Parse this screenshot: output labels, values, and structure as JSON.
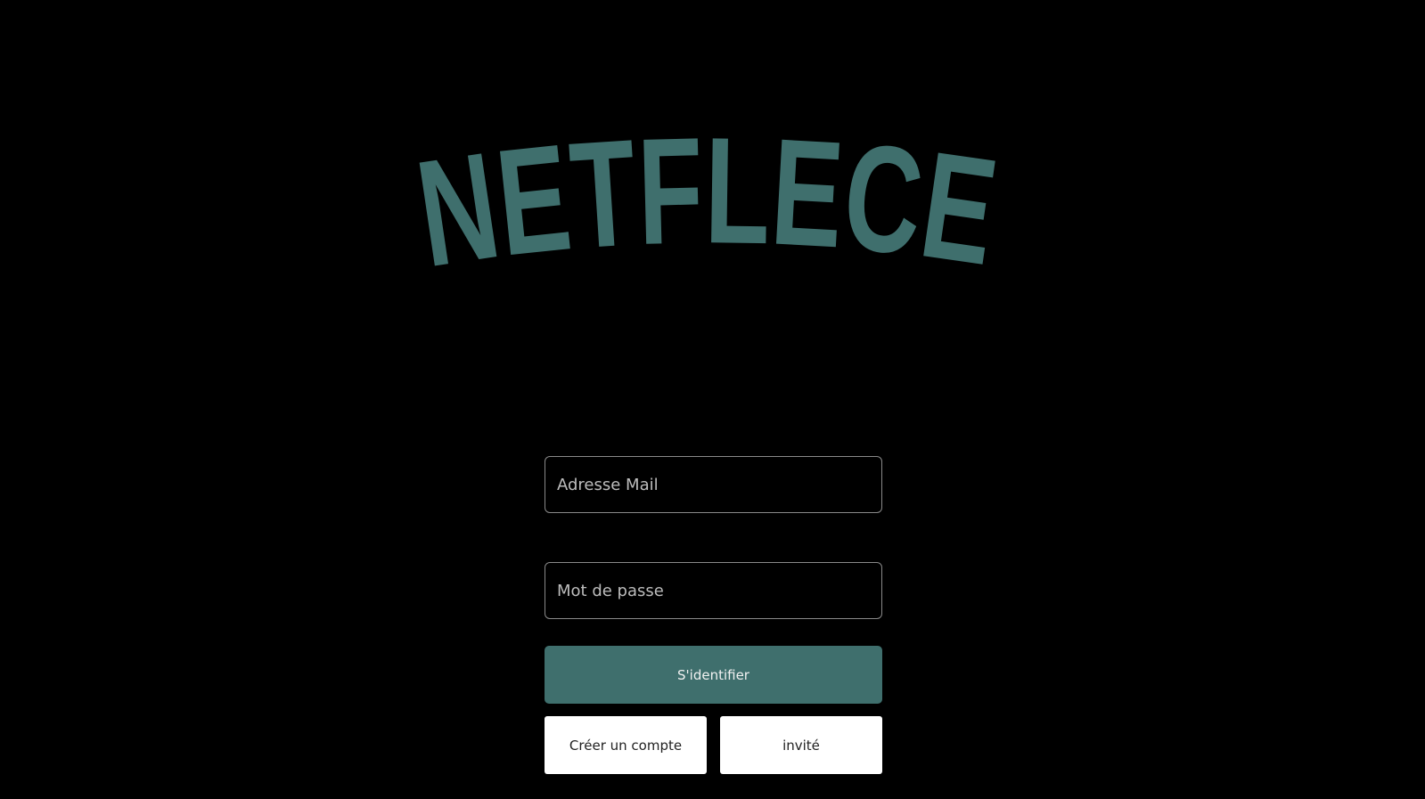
{
  "brand": {
    "logo_text": "NETFLECE",
    "logo_color": "#3f6f6d"
  },
  "login_form": {
    "email_placeholder": "Adresse Mail",
    "email_value": "",
    "password_placeholder": "Mot de passe",
    "password_value": "",
    "submit_label": "S'identifier",
    "create_account_label": "Créer un compte",
    "guest_label": "invité"
  },
  "colors": {
    "background": "#000000",
    "accent": "#3f6f6d",
    "secondary_button": "#ffffff"
  }
}
